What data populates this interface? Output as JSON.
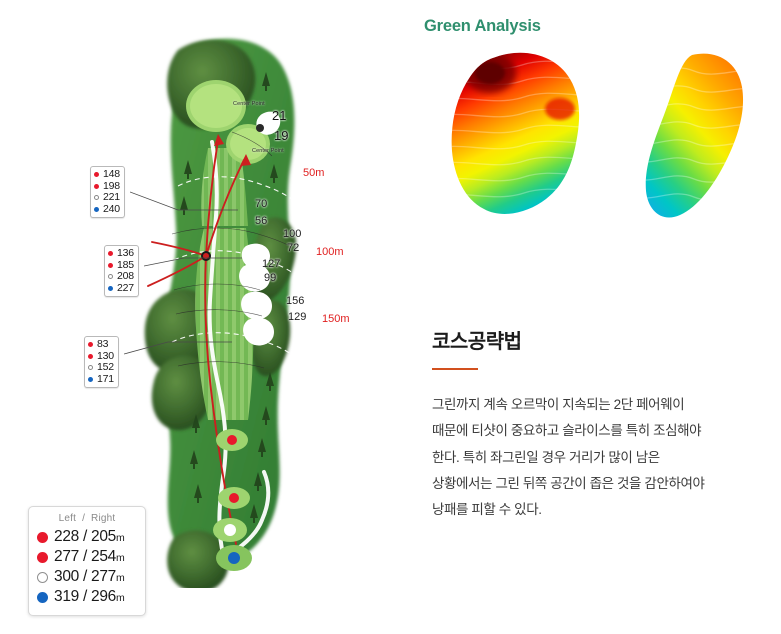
{
  "hole_map": {
    "distance_boxes": [
      {
        "name": "distance-box-upper",
        "rows": [
          {
            "marker": "red",
            "value": "148"
          },
          {
            "marker": "red",
            "value": "198"
          },
          {
            "marker": "white",
            "value": "221"
          },
          {
            "marker": "blue",
            "value": "240"
          }
        ]
      },
      {
        "name": "distance-box-middle",
        "rows": [
          {
            "marker": "red",
            "value": "136"
          },
          {
            "marker": "red",
            "value": "185"
          },
          {
            "marker": "white",
            "value": "208"
          },
          {
            "marker": "blue",
            "value": "227"
          }
        ]
      },
      {
        "name": "distance-box-lower",
        "rows": [
          {
            "marker": "red",
            "value": "83"
          },
          {
            "marker": "red",
            "value": "130"
          },
          {
            "marker": "white",
            "value": "152"
          },
          {
            "marker": "blue",
            "value": "171"
          }
        ]
      }
    ],
    "arc_labels": [
      "50m",
      "100m",
      "150m"
    ],
    "green_numbers": [
      "21",
      "19"
    ],
    "center_point_labels": [
      "Center Point",
      "Center Point"
    ],
    "bunker_numbers": [
      {
        "top": "70",
        "bottom": "56"
      },
      {
        "top": "100",
        "bottom": "72"
      },
      {
        "top": "127",
        "bottom": "99"
      },
      {
        "top": "156",
        "bottom": "129"
      }
    ]
  },
  "tee_legend": {
    "header_left": "Left",
    "header_sep": "/",
    "header_right": "Right",
    "rows": [
      {
        "marker": "red",
        "left": "228",
        "sep": "/",
        "right": "205",
        "unit": "m"
      },
      {
        "marker": "red",
        "left": "277",
        "sep": "/",
        "right": "254",
        "unit": "m"
      },
      {
        "marker": "white",
        "left": "300",
        "sep": "/",
        "right": "277",
        "unit": "m"
      },
      {
        "marker": "blue",
        "left": "319",
        "sep": "/",
        "right": "296",
        "unit": "m"
      }
    ]
  },
  "right_panel": {
    "green_analysis_title": "Green Analysis",
    "strategy_title": "코스공략법",
    "strategy_lines": [
      "그린까지 계속 오르막이 지속되는 2단 페어웨이",
      "때문에 티샷이 중요하고 슬라이스를 특히 조심해야",
      "한다. 특히 좌그린일 경우 거리가 많이 남은",
      "상황에서는 그린 뒤쪽 공간이 좁은 것을 감안하여야",
      "낭패를 피할 수 있다."
    ]
  },
  "colors": {
    "brand_green": "#2f8f6e",
    "accent_orange": "#d2501e",
    "tee_red": "#e8192c",
    "tee_blue": "#1565c0",
    "tee_white": "#ffffff",
    "arc_red": "#e02020"
  }
}
